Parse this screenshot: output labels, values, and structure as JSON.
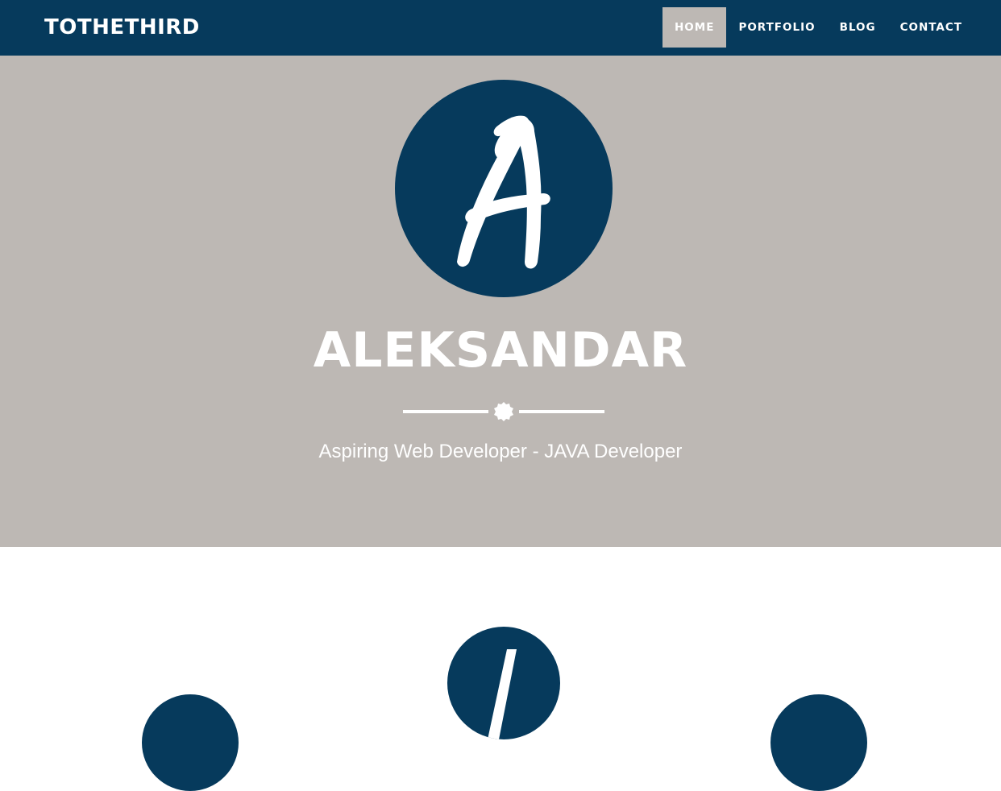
{
  "header": {
    "brand": "TOTHETHIRD",
    "nav": [
      {
        "label": "HOME",
        "active": true
      },
      {
        "label": "PORTFOLIO",
        "active": false
      },
      {
        "label": "BLOG",
        "active": false
      },
      {
        "label": "CONTACT",
        "active": false
      }
    ]
  },
  "hero": {
    "name": "ALEKSANDAR",
    "tagline": "Aspiring Web Developer - JAVA Developer",
    "avatar_icon": "letter-a-logo-icon",
    "divider_icon": "star-badge-icon"
  },
  "services": {
    "icons": [
      "skill-icon",
      "pencil-icon",
      "skill-icon"
    ]
  },
  "colors": {
    "primary": "#063a5c",
    "hero_bg": "#bdb8b4",
    "text_light": "#ffffff",
    "page_bg": "#ffffff"
  }
}
